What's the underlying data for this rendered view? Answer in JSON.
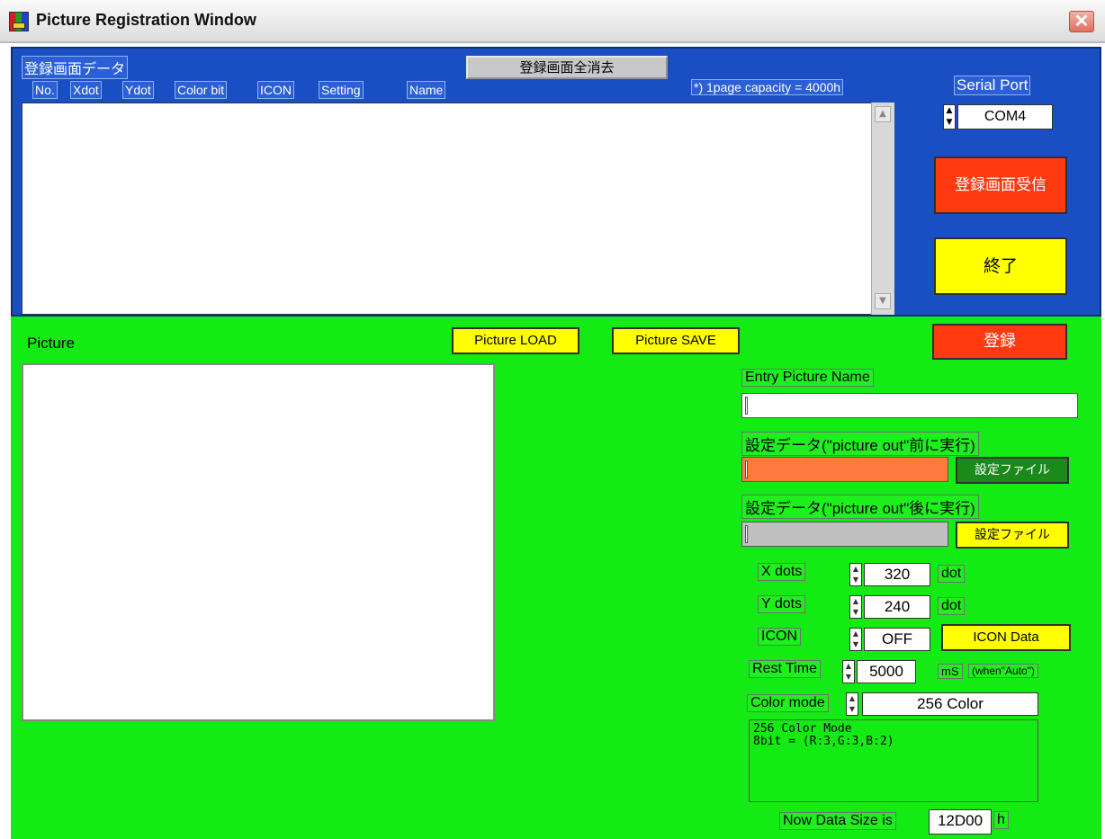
{
  "window": {
    "title": "Picture Registration Window",
    "close_symbol": "✕"
  },
  "registered": {
    "section_label": "登録画面データ",
    "delete_all_label": "登録画面全消去",
    "capacity_note": "*) 1page capacity = 4000h",
    "columns": [
      "No.",
      "Xdot",
      "Ydot",
      "Color bit",
      "ICON",
      "Setting",
      "Name"
    ],
    "rows": []
  },
  "serial": {
    "label": "Serial Port",
    "port": "COM4"
  },
  "receive_label": "登録画面受信",
  "exit_label": "終了",
  "picture": {
    "label": "Picture",
    "load_label": "Picture LOAD",
    "save_label": "Picture SAVE",
    "register_label": "登録"
  },
  "entry_name": {
    "label": "Entry Picture Name",
    "value": ""
  },
  "pre_setting": {
    "label": "設定データ(\"picture out\"前に実行)",
    "value": "",
    "file_button": "設定ファイル"
  },
  "post_setting": {
    "label": "設定データ(\"picture out\"後に実行)",
    "value": "",
    "file_button": "設定ファイル"
  },
  "params": {
    "x_dots": {
      "label": "X dots",
      "value": "320",
      "unit": "dot"
    },
    "y_dots": {
      "label": "Y dots",
      "value": "240",
      "unit": "dot"
    },
    "icon": {
      "label": "ICON",
      "value": "OFF",
      "button": "ICON Data"
    },
    "rest_time": {
      "label": "Rest Time",
      "value": "5000",
      "unit": "mS",
      "note": "(when\"Auto\")"
    },
    "color_mode": {
      "label": "Color mode",
      "value": "256 Color"
    }
  },
  "color_info": "256 Color Mode\n8bit = (R:3,G:3,B:2)",
  "data_size": {
    "label": "Now Data Size is",
    "value": "12D00",
    "unit": "h"
  },
  "colors": {
    "top_panel": "#1a4fc4",
    "bottom_panel": "#14eb14",
    "red_button": "#ff3a10",
    "yellow_button": "#ffff00",
    "orange_field": "#ff7a3c",
    "dark_green_button": "#1a8a1a"
  }
}
